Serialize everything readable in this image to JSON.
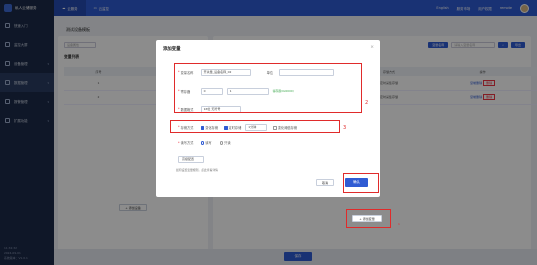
{
  "app": {
    "title": "私人云储服务",
    "tabs": [
      "云服务",
      "云监控"
    ],
    "right": [
      "English",
      "服务市场",
      "用户权限",
      "remote"
    ]
  },
  "sidebar": {
    "items": [
      {
        "label": "快速入门"
      },
      {
        "label": "监控大屏"
      },
      {
        "label": "设备管理"
      },
      {
        "label": "数据管理"
      },
      {
        "label": "报警管理"
      },
      {
        "label": "扩展功能"
      }
    ],
    "footer": [
      "11:32:32",
      "2024-09-01",
      "系统版本：V1.0.1"
    ]
  },
  "page": {
    "title": "测试设备模板",
    "filter_placeholder": "设备属性",
    "left_panel_title": "变量列表",
    "left_columns": [
      "序号",
      "名称"
    ],
    "left_rows": [
      [
        "1",
        "1"
      ],
      [
        "2",
        "2"
      ]
    ],
    "add_button": "+ 添加设备",
    "search_placeholder": "请输入变量名称",
    "search_button": "变量名称",
    "export_button": "导出",
    "right_columns": [
      "名称",
      "采集方式",
      "数据类型",
      "存储方式",
      "操作"
    ],
    "right_rows": [
      {
        "name": "v1",
        "mode": "定时采集",
        "type": "Float",
        "store": "定时采集存储",
        "edit": "复制删除",
        "del": "删除"
      },
      {
        "name": "v2",
        "mode": "定时采集",
        "type": "Float",
        "store": "定时采集存储",
        "edit": "复制删除",
        "del": "删除"
      }
    ],
    "right_add_button": "+ 添加变量",
    "save_button": "保存"
  },
  "dialog": {
    "title": "添加变量",
    "name_label": "变量名称",
    "name_value": "开关量_设备名称_02",
    "unit_label": "单位",
    "unit_value": "",
    "addr_label": "寄存器",
    "addr_value1": "0",
    "addr_value2": "1",
    "addr_hint": "寄存器(0x0000)",
    "format_label": "数据格式",
    "format_value": "16位 无符号",
    "store_label": "存储方式",
    "store_opt1": "变化存储",
    "store_opt2": "定时存储",
    "store_interval": "1分钟",
    "store_opt3": "变化阈值存储",
    "rw_label": "读写方式",
    "rw_opt1": "读写",
    "rw_opt2": "只读",
    "advanced_label": "高级配置",
    "hint_text": "如何设置变量规则，点此查看详情",
    "cancel": "取消",
    "confirm": "确认"
  },
  "annotations": [
    "2",
    "3",
    "1"
  ]
}
